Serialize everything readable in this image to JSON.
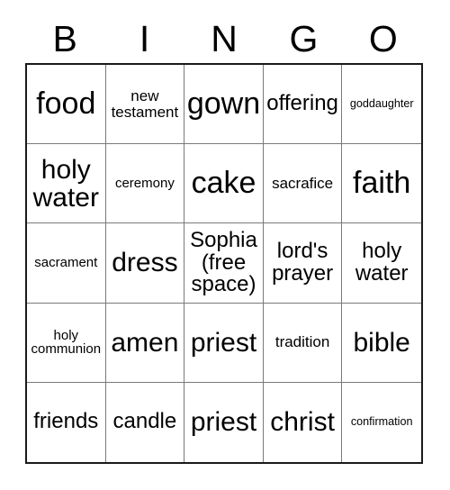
{
  "card": {
    "type": "bingo-card",
    "header_letters": [
      "B",
      "I",
      "N",
      "G",
      "O"
    ],
    "colors": {
      "background": "#ffffff",
      "text": "#000000",
      "outer_border": "#1a1a1a",
      "inner_border": "#7a7a7a"
    },
    "free_space": {
      "row": 3,
      "column": 3,
      "label": "Sophia (free space)"
    },
    "rows": [
      [
        {
          "text": "food",
          "size": "xl"
        },
        {
          "text": "new testament",
          "size": "sm"
        },
        {
          "text": "gown",
          "size": "xl"
        },
        {
          "text": "offering",
          "size": "md"
        },
        {
          "text": "goddaughter",
          "size": "xxs"
        }
      ],
      [
        {
          "text": "holy water",
          "size": "lg"
        },
        {
          "text": "ceremony",
          "size": "xs"
        },
        {
          "text": "cake",
          "size": "xl"
        },
        {
          "text": "sacrafice",
          "size": "sm"
        },
        {
          "text": "faith",
          "size": "xl"
        }
      ],
      [
        {
          "text": "sacrament",
          "size": "xs"
        },
        {
          "text": "dress",
          "size": "lg"
        },
        {
          "text": "Sophia (free space)",
          "size": "md"
        },
        {
          "text": "lord's prayer",
          "size": "md"
        },
        {
          "text": "holy water",
          "size": "md"
        }
      ],
      [
        {
          "text": "holy communion",
          "size": "xs"
        },
        {
          "text": "amen",
          "size": "lg"
        },
        {
          "text": "priest",
          "size": "lg"
        },
        {
          "text": "tradition",
          "size": "sm"
        },
        {
          "text": "bible",
          "size": "lg"
        }
      ],
      [
        {
          "text": "friends",
          "size": "md"
        },
        {
          "text": "candle",
          "size": "md"
        },
        {
          "text": "priest",
          "size": "lg"
        },
        {
          "text": "christ",
          "size": "lg"
        },
        {
          "text": "confirmation",
          "size": "xxs"
        }
      ]
    ]
  }
}
